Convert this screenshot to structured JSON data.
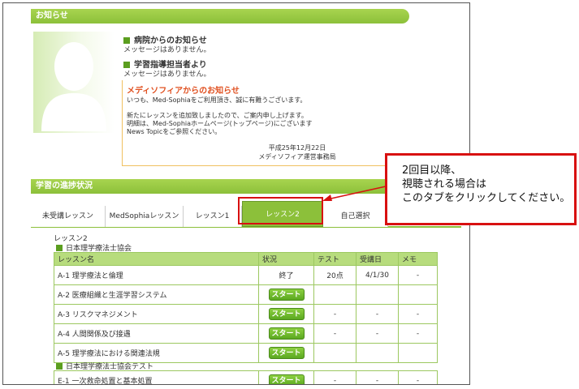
{
  "news": {
    "section_title": "お知らせ",
    "hospital_title": "病院からのお知らせ",
    "hospital_msg": "メッセージはありません。",
    "instructor_title": "学習指導担当者より",
    "instructor_msg": "メッセージはありません。",
    "notice_title": "メディソフィアからのお知らせ",
    "notice_lines": [
      "いつも、Med-Sophiaをご利用頂き、誠に有難うございます。",
      "新たにレッスンを追加致しましたので、ご案内申し上げます。",
      "明細は、Med-Sophiaホームページ(トップページ)にございます",
      "News Topicをご参照ください。"
    ],
    "notice_date": "平成25年12月22日",
    "notice_org": "メディソフィア運営事務局"
  },
  "progress": {
    "section_title": "学習の進捗状況",
    "tabs": [
      "未受講レッスン",
      "MedSophiaレッスン",
      "レッスン1",
      "レッスン2",
      "自己選択"
    ],
    "active_tab": 3,
    "lesson_heading": "レッスン2",
    "groups": [
      {
        "title": "日本理学療法士協会",
        "headers": [
          "レッスン名",
          "状況",
          "テスト",
          "受講日",
          "メモ"
        ],
        "rows": [
          {
            "name": "A-1 理学療法と倫理",
            "status": "終了",
            "test": "20点",
            "date": "4/1/30",
            "memo": "-"
          },
          {
            "name": "A-2 医療組織と生涯学習システム",
            "status": "スタート",
            "test": "",
            "date": "",
            "memo": ""
          },
          {
            "name": "A-3 リスクマネジメント",
            "status": "スタート",
            "test": "-",
            "date": "-",
            "memo": "-"
          },
          {
            "name": "A-4 人間関係及び接遇",
            "status": "スタート",
            "test": "-",
            "date": "-",
            "memo": "-"
          },
          {
            "name": "A-5 理学療法における関連法規",
            "status": "スタート",
            "test": "",
            "date": "",
            "memo": ""
          }
        ]
      },
      {
        "title": "日本理学療法士協会テスト",
        "rows": [
          {
            "name": "E-1 一次救命処置と基本処置",
            "status": "スタート",
            "test": "-",
            "date": "-",
            "memo": "-"
          }
        ]
      }
    ]
  },
  "callout": {
    "lines": [
      "2回目以降、",
      "視聴される場合は",
      "このタブをクリックしてください。"
    ]
  },
  "colors": {
    "accent_green": "#8cc03a",
    "callout_red": "#d81010",
    "notice_orange": "#e05020"
  }
}
